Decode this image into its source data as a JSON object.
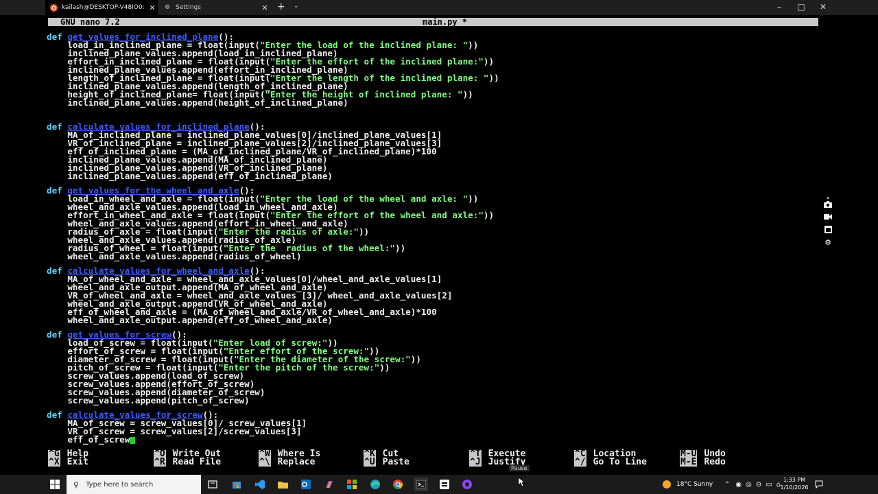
{
  "tabs": [
    {
      "label": "kailash@DESKTOP-V48IO0: ~",
      "close": "✕"
    },
    {
      "label": "Settings",
      "close": "✕"
    }
  ],
  "window": {
    "new_tab": "+",
    "dropdown": "⌄",
    "minimize": "–",
    "maximize": "□",
    "close": "✕"
  },
  "nano": {
    "version": "GNU nano 7.2",
    "filename": "main.py *"
  },
  "code": {
    "L1": [
      "def ",
      "get_values_for_inclined_plane",
      "():"
    ],
    "L2": [
      "    load_in_inclined_plane = float(input(",
      "\"Enter the load of the inclined plane: \"",
      "))"
    ],
    "L3": "    inclined_plane_values.append(load_in_inclined_plane)",
    "L4": [
      "    effort_in_inclined_plane = float(input(",
      "\"Enter the effort of the inclined plane:\"",
      "))"
    ],
    "L5": "    inclined_plane_values.append(effort_in_inclined_plane)",
    "L6": [
      "    length_of_inclined_plane = float(input(",
      "\"Enter the length of the inclined plane: \"",
      "))"
    ],
    "L7": "    inclined_plane_values.append(length_of_inclined_plane)",
    "L8": [
      "    height_of_inclined_plane= float(input(",
      "\"Enter the height of inclined plane: \"",
      "))"
    ],
    "L9": "    inclined_plane_values.append(height_of_inclined_plane)",
    "L10": [
      "def ",
      "calculate_values_for_inclined_plane",
      "():"
    ],
    "L11": "    MA_of_inclined_plane = inclined_plane_values[0]/inclined_plane_values[1]",
    "L12": "    VR_of_inclined_plane = inclined_plane_values[2]/inclined_plane_values[3]",
    "L13": "    eff_of_inclined_plane = (MA_of_inclined_plane/VR_of_inclined_plane)*100",
    "L14": "    inclined_plane_values.append(MA_of_inclined_plane)",
    "L15": "    inclined_plane_values.append(VR_of_inclined_plane)",
    "L16": "    inclined_plane_values.append(eff_of_inclined_plane)",
    "L17": [
      "def ",
      "get_values_for_the_wheel_and_axle",
      "():"
    ],
    "L18": [
      "    load_in_wheel_and_axle = float(input(",
      "\"Enter the load of the wheel and axle: \"",
      "))"
    ],
    "L19": "    wheel_and_axle_values.append(load_in_wheel_and_axle)",
    "L20": [
      "    effort_in_wheel_and_axle = float(input(",
      "\"Enter the effort of the wheel and axle:\"",
      "))"
    ],
    "L21": "    wheel_and_axle_values.append(effort_in_wheel_and_axle)",
    "L22": [
      "    radius_of_axle = float(input(",
      "\"Enter the radius of axle:\"",
      "))"
    ],
    "L23": "    wheel_and_axle_values.append(radius_of_axle)",
    "L24": [
      "    radius_of_wheel = float(input(",
      "\"Enter the  radius of the wheel:\"",
      "))"
    ],
    "L25": "    wheel_and_axle_values.append(radius_of_wheel)",
    "L26": [
      "def ",
      "calculate_values_for_wheel_and_axle",
      "():"
    ],
    "L27": "    MA_of_wheel_and_axle = wheel_and_axle_values[0]/wheel_and_axle_values[1]",
    "L28": "    wheel_and_axle_output.append(MA_of_wheel_and_axle)",
    "L29": "    VR_of_wheel_and_axle = wheel_and_axle_values [3]/ wheel_and_axle_values[2]",
    "L30": "    wheel_and_axle_output.append(VR_of_wheel_and_axle)",
    "L31": "    eff_of_wheel_and_axle = (MA_of_wheel_and_axle/VR_of_wheel_and_axle)*100",
    "L32": "    wheel_and_axle_output.append(eff_of_wheel_and_axle)",
    "L33": [
      "def ",
      "get_values_for_screw",
      "():"
    ],
    "L34": [
      "    load_of_screw = float(input(",
      "\"Enter load of screw:\"",
      "))"
    ],
    "L35": [
      "    effort_of_screw = float(input(",
      "\"Enter effort of the screw:\"",
      "))"
    ],
    "L36": [
      "    diameter_of_screw = float(input(",
      "\"Enter the diameter of the screw:\"",
      "))"
    ],
    "L37": [
      "    pitch_of_screw = float(input(",
      "\"Enter the pitch of the screw:\"",
      "))"
    ],
    "L38": "    screw_values.append(load_of_screw)",
    "L39": "    screw_values.append(effort_of_screw)",
    "L40": "    screw_values.append(diameter_of_screw)",
    "L41": "    screw_values.append(pitch_of_screw)",
    "L42": [
      "def ",
      "calculate_values_for_screw",
      "():"
    ],
    "L43": "    MA_of_screw = screw_values[0]/ screw_values[1]",
    "L44": "    VR_of_screw = screw_values[2]/screw_values[3]",
    "L45": "    eff_of_screw"
  },
  "shortcuts": [
    {
      "k1": "^G",
      "l1": "Help",
      "k2": "^X",
      "l2": "Exit"
    },
    {
      "k1": "^O",
      "l1": "Write Out",
      "k2": "^R",
      "l2": "Read File"
    },
    {
      "k1": "^W",
      "l1": "Where Is",
      "k2": "^\\",
      "l2": "Replace"
    },
    {
      "k1": "^K",
      "l1": "Cut",
      "k2": "^U",
      "l2": "Paste"
    },
    {
      "k1": "^T",
      "l1": "Execute",
      "k2": "^J",
      "l2": "Justify"
    },
    {
      "k1": "^C",
      "l1": "Location",
      "k2": "^/",
      "l2": "Go To Line"
    },
    {
      "k1": "M-U",
      "l1": "Undo",
      "k2": "M-E",
      "l2": "Redo"
    }
  ],
  "tooltip": "Pause",
  "taskbar": {
    "search_placeholder": "Type here to search",
    "weather": "18°C  Sunny",
    "time": "1:33 PM",
    "date": "1/10/2026"
  },
  "colors": {
    "keyword": "#5fd7ff",
    "function": "#3b5bff",
    "string": "#7dff7d",
    "cursor": "#22d022"
  }
}
